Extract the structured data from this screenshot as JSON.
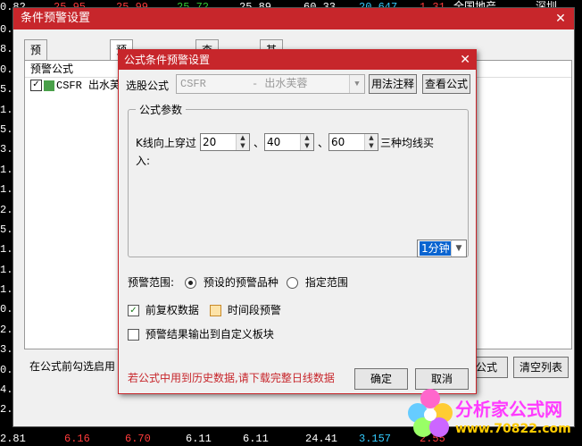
{
  "background": {
    "top_row": [
      "0.82",
      "25.95",
      "25.99",
      "25.72",
      "25.89",
      "60.33",
      "20.647",
      "1.31",
      "全国地产",
      "深圳"
    ],
    "bottom_row": [
      "2.81",
      "6.16",
      "6.70",
      "6.11",
      "6.11",
      "24.41",
      "3.157",
      "2.55",
      "",
      ""
    ],
    "left_numbers": [
      "0.",
      "8.",
      "0.",
      "5.",
      "1.",
      "5.",
      "3.",
      "1.",
      "1.",
      "2.",
      "5.",
      "1.",
      "1.",
      "1.",
      "0.",
      "2.",
      "3.",
      "0.",
      "4.",
      "2."
    ]
  },
  "outer_window": {
    "title": "条件预警设置",
    "close": "✕",
    "tabs": [
      "预警品种设置",
      "预警公式设置",
      "查看预警设置",
      "其它设置"
    ],
    "list_header": "预警公式",
    "list_rows": [
      {
        "checked": true,
        "text": "CSFR 出水芙蓉"
      }
    ],
    "bottom_hint": "在公式前勾选启用",
    "btn_formula": "公式",
    "btn_clear": "清空列表"
  },
  "dialog": {
    "title": "公式条件预警设置",
    "close": "✕",
    "select_label": "选股公式",
    "select_value": "CSFR",
    "select_name": "- 出水芙蓉",
    "btn_usage": "用法注释",
    "btn_view": "查看公式",
    "group_title": "公式参数",
    "param_text_a": "K线向上穿过",
    "param_sep": "、",
    "param_values": [
      "20",
      "40",
      "60"
    ],
    "param_text_b": "三种均线买",
    "param_text_c": "入:",
    "timeframe": "1分钟",
    "range_label": "预警范围:",
    "range_option1": "预设的预警品种",
    "range_option2": "指定范围",
    "chk_fq": "前复权数据",
    "chk_time": "时间段预警",
    "chk_output": "预警结果输出到自定义板块",
    "warning": "若公式中用到历史数据,请下载完整日线数据",
    "btn_ok": "确定",
    "btn_cancel": "取消"
  },
  "watermark": {
    "title": "分析家公式网",
    "url": "www.70822.com"
  },
  "colors": {
    "title_bar": "#c7262b",
    "accent_red": "#ff3b3b",
    "accent_green": "#33cc33",
    "selection_blue": "#0a64d0"
  }
}
